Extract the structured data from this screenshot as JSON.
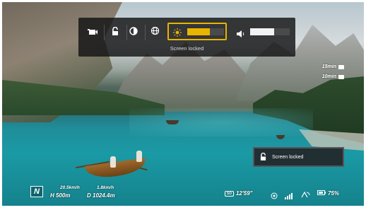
{
  "control_bar": {
    "buttons": [
      {
        "icon": "video-camera-icon"
      },
      {
        "icon": "unlock-icon"
      },
      {
        "icon": "contrast-icon"
      },
      {
        "icon": "gimbal-globe-icon"
      }
    ],
    "brightness": {
      "icon": "sun-icon",
      "level": 0.62,
      "accent_color": "#e8b400"
    },
    "volume": {
      "icon": "speaker-icon",
      "level": 0.6,
      "fill_color": "#f2f2f2"
    },
    "message": "Screen locked"
  },
  "right_overlay": {
    "items": [
      {
        "value": "15min",
        "icon": "battery-flight-icon"
      },
      {
        "value": "10min",
        "icon": "return-home-icon"
      }
    ]
  },
  "toast": {
    "icon": "unlock-icon",
    "text": "Screen locked"
  },
  "hud": {
    "compass_label": "N",
    "h_speed": "20.5km/h",
    "v_speed": "1.8km/h",
    "height_label": "H",
    "height_value": "500m",
    "distance_label": "D",
    "distance_value": "1024.4m",
    "sd_label": "SD",
    "record_time": "12'59\"",
    "gps_count": "",
    "signal_label": "",
    "battery_percent": "75%"
  }
}
